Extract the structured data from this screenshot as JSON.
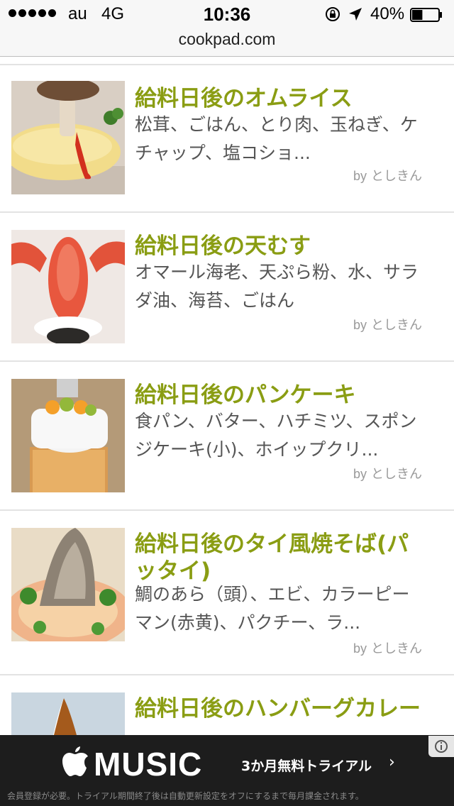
{
  "status_bar": {
    "carrier": "au",
    "network": "4G",
    "time": "10:36",
    "battery": "40%",
    "battery_level": 0.4
  },
  "address_bar": {
    "domain": "cookpad.com"
  },
  "recipes": [
    {
      "title": "給料日後のオムライス",
      "ingredients": "松茸、ごはん、とり肉、玉ねぎ、ケチャップ、塩コショ...",
      "author_prefix": "by",
      "author": "としきん"
    },
    {
      "title": "給料日後の天むす",
      "ingredients": "オマール海老、天ぷら粉、水、サラダ油、海苔、ごはん",
      "author_prefix": "by",
      "author": "としきん"
    },
    {
      "title": "給料日後のパンケーキ",
      "ingredients": "食パン、バター、ハチミツ、スポンジケーキ(小)、ホイップクリ...",
      "author_prefix": "by",
      "author": "としきん"
    },
    {
      "title": "給料日後のタイ風焼そば(パッタイ)",
      "ingredients": "鯛のあら（頭）、エビ、カラーピーマン(赤黄)、パクチー、ラ...",
      "author_prefix": "by",
      "author": "としきん"
    },
    {
      "title": "給料日後のハンバーグカレー",
      "ingredients": "",
      "author_prefix": "",
      "author": ""
    }
  ],
  "ad_banner": {
    "brand": "MUSIC",
    "cta": "3か月無料トライアル",
    "fine_print": "会員登録が必要。トライアル期間終了後は自動更新設定をオフにするまで毎月課金されます。"
  },
  "colors": {
    "title_green": "#8a9d13",
    "ingredient_gray": "#555555",
    "author_gray": "#999999",
    "ad_background": "#1d1d1d"
  },
  "icons": {
    "rotation_lock": "rotation-lock-icon",
    "location": "location-arrow-icon",
    "battery": "battery-icon",
    "apple": "apple-logo-icon",
    "ad_choices": "ad-choices-icon"
  }
}
